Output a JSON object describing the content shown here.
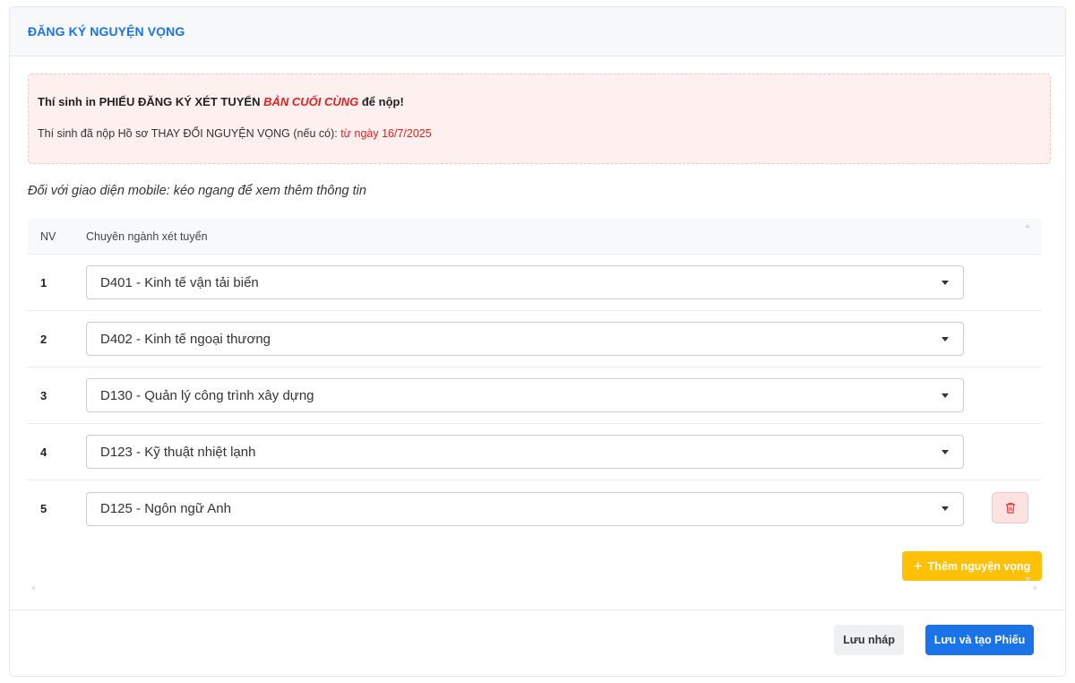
{
  "header": {
    "title": "ĐĂNG KÝ NGUYỆN VỌNG"
  },
  "alert": {
    "line1_prefix": "Thí sinh in PHIẾU ĐĂNG KÝ XÉT TUYỂN ",
    "line1_emphasis": "BẢN CUỐI CÙNG",
    "line1_suffix": " để nộp!",
    "line2_prefix": "Thí sinh đã nộp Hồ sơ THAY ĐỔI NGUYỆN VỌNG (nếu có): ",
    "line2_date": "từ ngày 16/7/2025"
  },
  "mobile_note": "Đối với giao diện mobile: kéo ngang để xem thêm thông tin",
  "table": {
    "columns": {
      "nv": "NV",
      "major": "Chuyên ngành xét tuyển"
    },
    "rows": [
      {
        "nv": "1",
        "major": "D401 - Kinh tế vận tải biển"
      },
      {
        "nv": "2",
        "major": "D402 - Kinh tế ngoại thương"
      },
      {
        "nv": "3",
        "major": "D130 - Quản lý công trình xây dựng"
      },
      {
        "nv": "4",
        "major": "D123 - Kỹ thuật nhiệt lạnh"
      },
      {
        "nv": "5",
        "major": "D125 - Ngôn ngữ Anh"
      }
    ]
  },
  "add_button": {
    "label": "Thêm nguyện vọng",
    "icon": "plus-icon"
  },
  "footer": {
    "draft_label": "Lưu nháp",
    "save_label": "Lưu và tạo Phiếu"
  },
  "colors": {
    "accent": "#1b73e8",
    "danger": "#e02020",
    "warning": "#ffc107",
    "alert_bg": "#fff0f0"
  }
}
